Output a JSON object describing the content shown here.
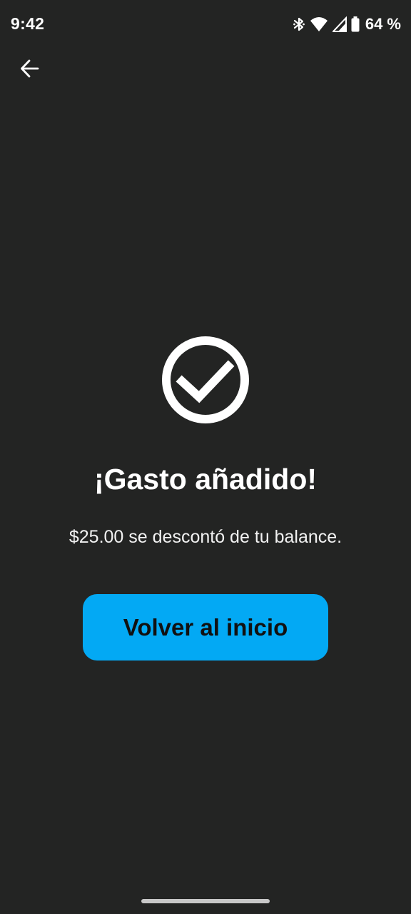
{
  "status_bar": {
    "time": "9:42",
    "battery": "64 %",
    "icons": [
      "bluetooth-icon",
      "wifi-icon",
      "cell-signal-icon",
      "battery-icon"
    ]
  },
  "nav": {
    "back_icon": "arrow-left-icon"
  },
  "success": {
    "icon": "check-circle-icon",
    "title": "¡Gasto añadido!",
    "message": "$25.00 se descontó de tu balance."
  },
  "actions": {
    "home_label": "Volver al inicio"
  },
  "colors": {
    "background": "#232423",
    "accent": "#03a9f4",
    "text": "#ffffff",
    "button_text": "#111111"
  }
}
